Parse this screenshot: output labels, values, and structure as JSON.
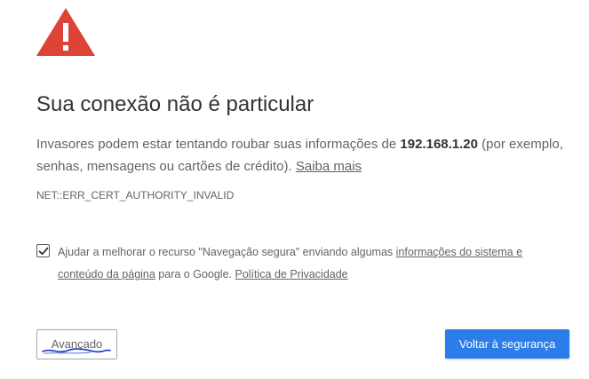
{
  "interstitial": {
    "title": "Sua conexão não é particular",
    "body_prefix": "Invasores podem estar tentando roubar suas informações de ",
    "host": "192.168.1.20",
    "body_suffix": " (por exemplo, senhas, mensagens ou cartões de crédito). ",
    "learn_more_link": "Saiba mais",
    "error_code": "NET::ERR_CERT_AUTHORITY_INVALID"
  },
  "safe_browsing_optin": {
    "checked": true,
    "text_prefix": "Ajudar a melhorar o recurso \"Navegação segura\" enviando algumas ",
    "system_info_link": "informações do sistema e conteúdo da página",
    "text_middle": " para o Google. ",
    "privacy_link": "Política de Privacidade"
  },
  "buttons": {
    "advanced_label": "Avançado",
    "back_to_safety_label": "Voltar à segurança"
  },
  "colors": {
    "warning_red": "#db4437",
    "primary_blue": "#2b7de9",
    "annotation_ink": "#1a33c8"
  },
  "icons": {
    "warning": "warning-triangle-icon",
    "checkmark": "checkmark-icon"
  }
}
